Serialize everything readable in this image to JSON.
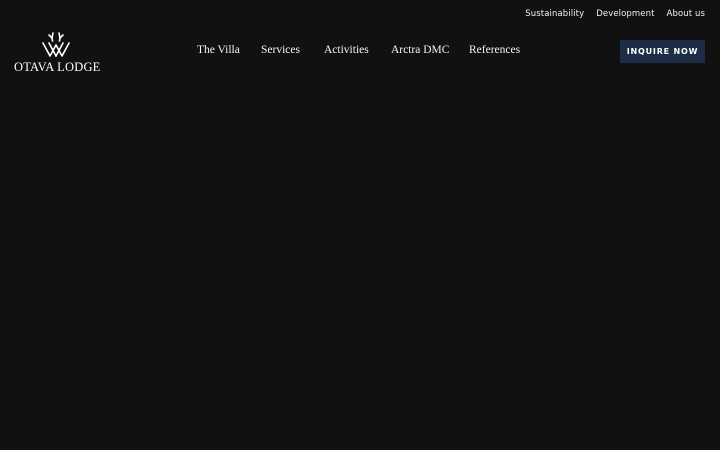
{
  "top_links": {
    "sustainability": "Sustainability",
    "development": "Development",
    "about": "About us"
  },
  "logo": {
    "icon": "antler-monogram-icon",
    "text": "OTAVA LODGE"
  },
  "main_nav": {
    "villa": "The Villa",
    "services": "Services",
    "activities": "Activities",
    "arctra": "Arctra DMC",
    "references": "References"
  },
  "cta": {
    "label": "INQUIRE NOW"
  },
  "colors": {
    "background": "#111112",
    "button": "#1d2d45",
    "text": "#ffffff"
  }
}
